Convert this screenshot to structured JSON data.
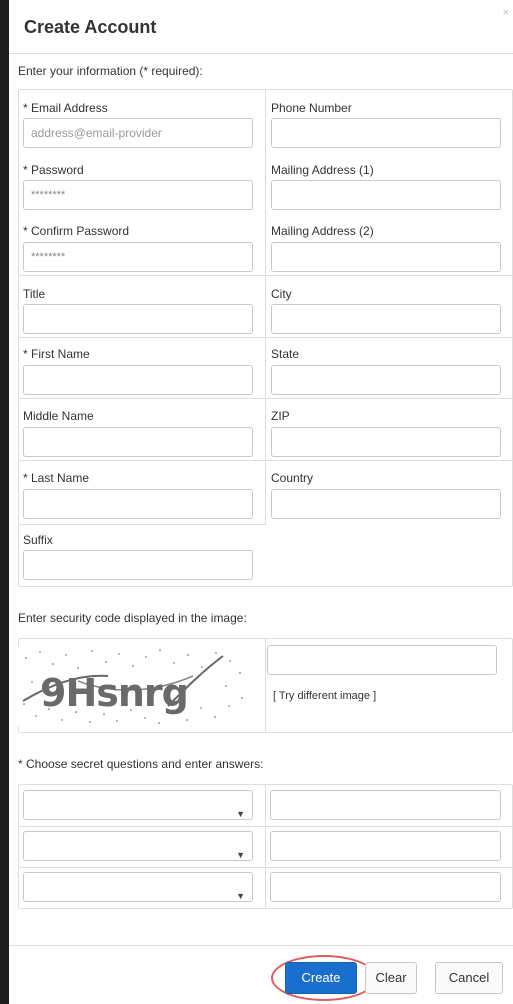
{
  "dialog": {
    "title": "Create Account",
    "close_glyph": "×"
  },
  "info_section": {
    "heading": "Enter your information (* required):",
    "left_fields": [
      {
        "label": "* Email Address",
        "placeholder": "address@email-provider",
        "value": ""
      },
      {
        "label": "* Password",
        "placeholder": "",
        "value": "********"
      },
      {
        "label": "* Confirm Password",
        "placeholder": "",
        "value": "********"
      },
      {
        "label": "Title",
        "placeholder": "",
        "value": ""
      },
      {
        "label": "* First Name",
        "placeholder": "",
        "value": ""
      },
      {
        "label": "Middle Name",
        "placeholder": "",
        "value": ""
      },
      {
        "label": "* Last Name",
        "placeholder": "",
        "value": ""
      },
      {
        "label": "Suffix",
        "placeholder": "",
        "value": ""
      }
    ],
    "right_fields": [
      {
        "label": "Phone Number",
        "value": ""
      },
      {
        "label": "Mailing Address (1)",
        "value": ""
      },
      {
        "label": "Mailing Address (2)",
        "value": ""
      },
      {
        "label": "City",
        "value": ""
      },
      {
        "label": "State",
        "value": ""
      },
      {
        "label": "ZIP",
        "value": ""
      },
      {
        "label": "Country",
        "value": ""
      }
    ]
  },
  "security": {
    "heading": "Enter security code displayed in the image:",
    "captcha_text": "9Hsnrg",
    "try_link": "[ Try different image ]",
    "input_value": ""
  },
  "secret_questions": {
    "heading": "* Choose secret questions and enter answers:",
    "rows": [
      {
        "question": "",
        "answer": ""
      },
      {
        "question": "",
        "answer": ""
      },
      {
        "question": "",
        "answer": ""
      }
    ],
    "dropdown_arrow": "▼"
  },
  "footer": {
    "create_label": "Create",
    "clear_label": "Clear",
    "cancel_label": "Cancel"
  },
  "colors": {
    "primary_button": "#1a6fce",
    "highlight_ring": "#e05a5a",
    "backdrop": "#1f1f1f"
  }
}
